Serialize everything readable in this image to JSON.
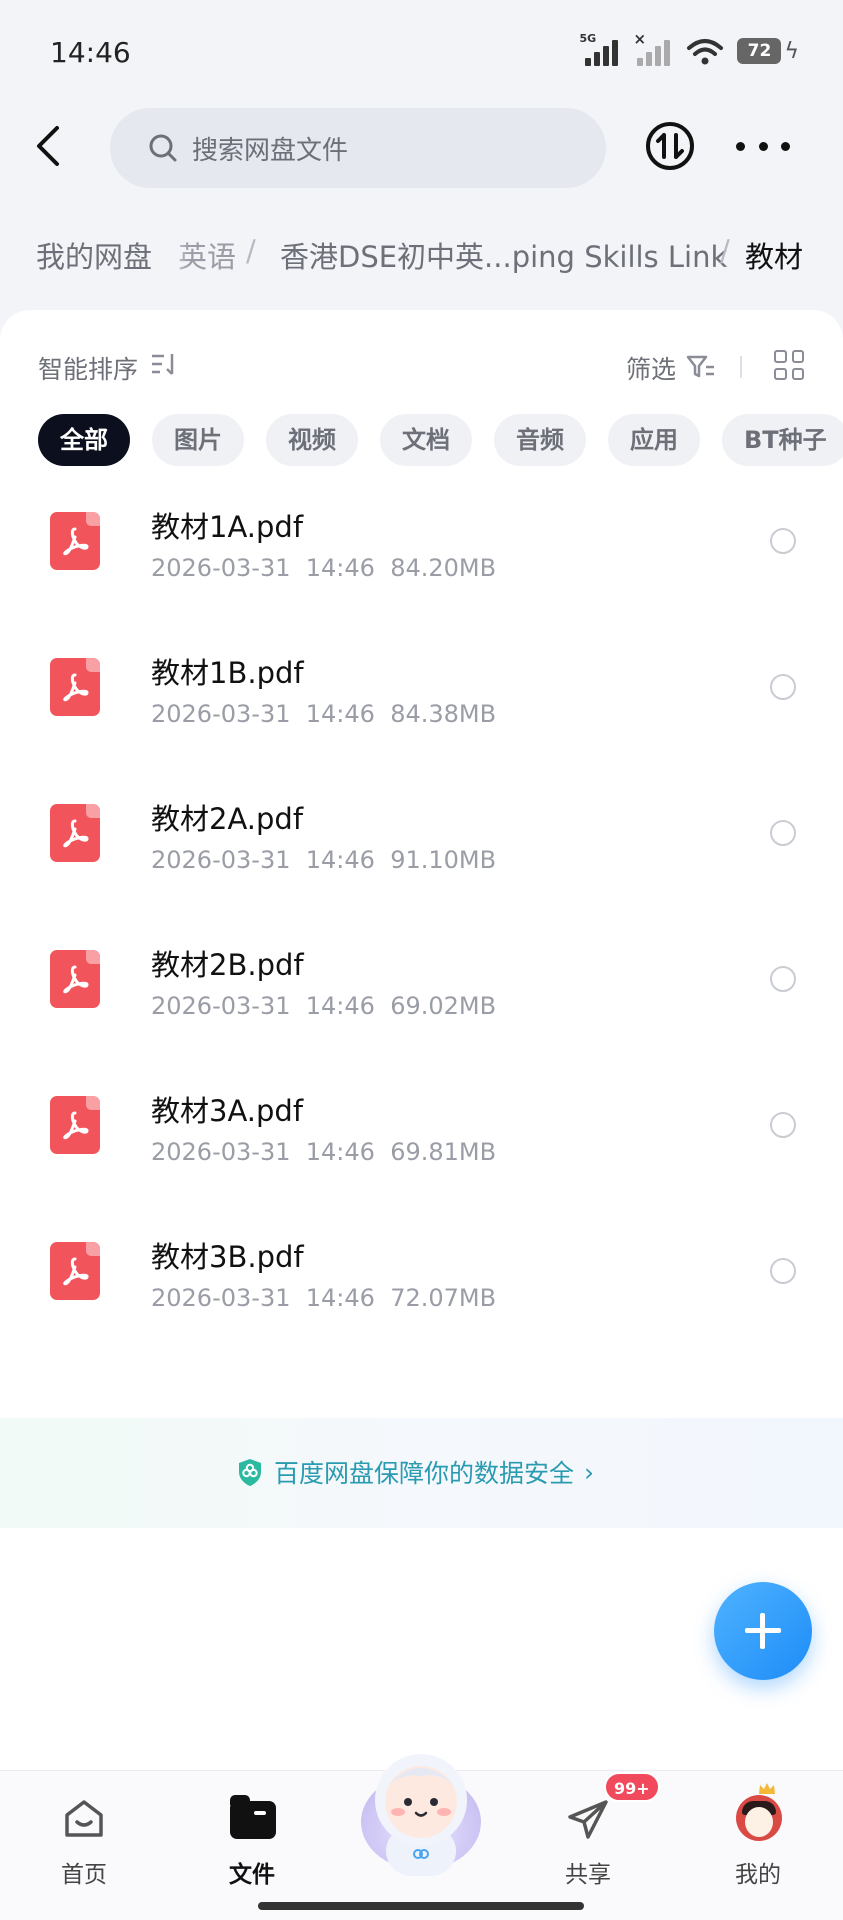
{
  "status_bar": {
    "time": "14:46",
    "network": "5G",
    "battery": "72",
    "icons": [
      "signal-icon",
      "signal-off-icon",
      "wifi-icon",
      "battery-icon",
      "charging-icon"
    ]
  },
  "top_nav": {
    "search_placeholder": "搜索网盘文件",
    "icons": [
      "back-icon",
      "search-icon",
      "transfer-icon",
      "more-icon"
    ]
  },
  "breadcrumb": {
    "root": "我的网盘",
    "cut_item": "英语",
    "middle": "香港DSE初中英...ping Skills Link",
    "current": "教材",
    "separator": "/"
  },
  "toolbar": {
    "sort_label": "智能排序",
    "filter_label": "筛选",
    "icons": [
      "sort-icon",
      "filter-icon",
      "grid-view-icon"
    ]
  },
  "filter_chips": [
    {
      "label": "全部",
      "active": true
    },
    {
      "label": "图片",
      "active": false
    },
    {
      "label": "视频",
      "active": false
    },
    {
      "label": "文档",
      "active": false
    },
    {
      "label": "音频",
      "active": false
    },
    {
      "label": "应用",
      "active": false
    },
    {
      "label": "BT种子",
      "active": false
    }
  ],
  "files": [
    {
      "name": "教材1A.pdf",
      "date": "2026-03-31",
      "time": "14:46",
      "size": "84.20MB"
    },
    {
      "name": "教材1B.pdf",
      "date": "2026-03-31",
      "time": "14:46",
      "size": "84.38MB"
    },
    {
      "name": "教材2A.pdf",
      "date": "2026-03-31",
      "time": "14:46",
      "size": "91.10MB"
    },
    {
      "name": "教材2B.pdf",
      "date": "2026-03-31",
      "time": "14:46",
      "size": "69.02MB"
    },
    {
      "name": "教材3A.pdf",
      "date": "2026-03-31",
      "time": "14:46",
      "size": "69.81MB"
    },
    {
      "name": "教材3B.pdf",
      "date": "2026-03-31",
      "time": "14:46",
      "size": "72.07MB"
    }
  ],
  "security_banner": {
    "text": "百度网盘保障你的数据安全",
    "chevron": "›"
  },
  "fab": {
    "icon": "plus-icon"
  },
  "bottom_nav": {
    "items": [
      {
        "label": "首页",
        "icon": "home-icon",
        "active": false
      },
      {
        "label": "文件",
        "icon": "folder-icon",
        "active": true
      },
      {
        "label": "",
        "icon": "mascot-icon",
        "active": false
      },
      {
        "label": "共享",
        "icon": "share-icon",
        "active": false
      },
      {
        "label": "我的",
        "icon": "avatar-icon",
        "active": false
      }
    ],
    "share_badge": "99+"
  },
  "colors": {
    "accent_blue": "#1d8cf8",
    "pdf_red": "#f2545b",
    "active_chip": "#0c0f1e",
    "badge_red": "#f04a5c",
    "security_teal": "#2a9bb0"
  }
}
